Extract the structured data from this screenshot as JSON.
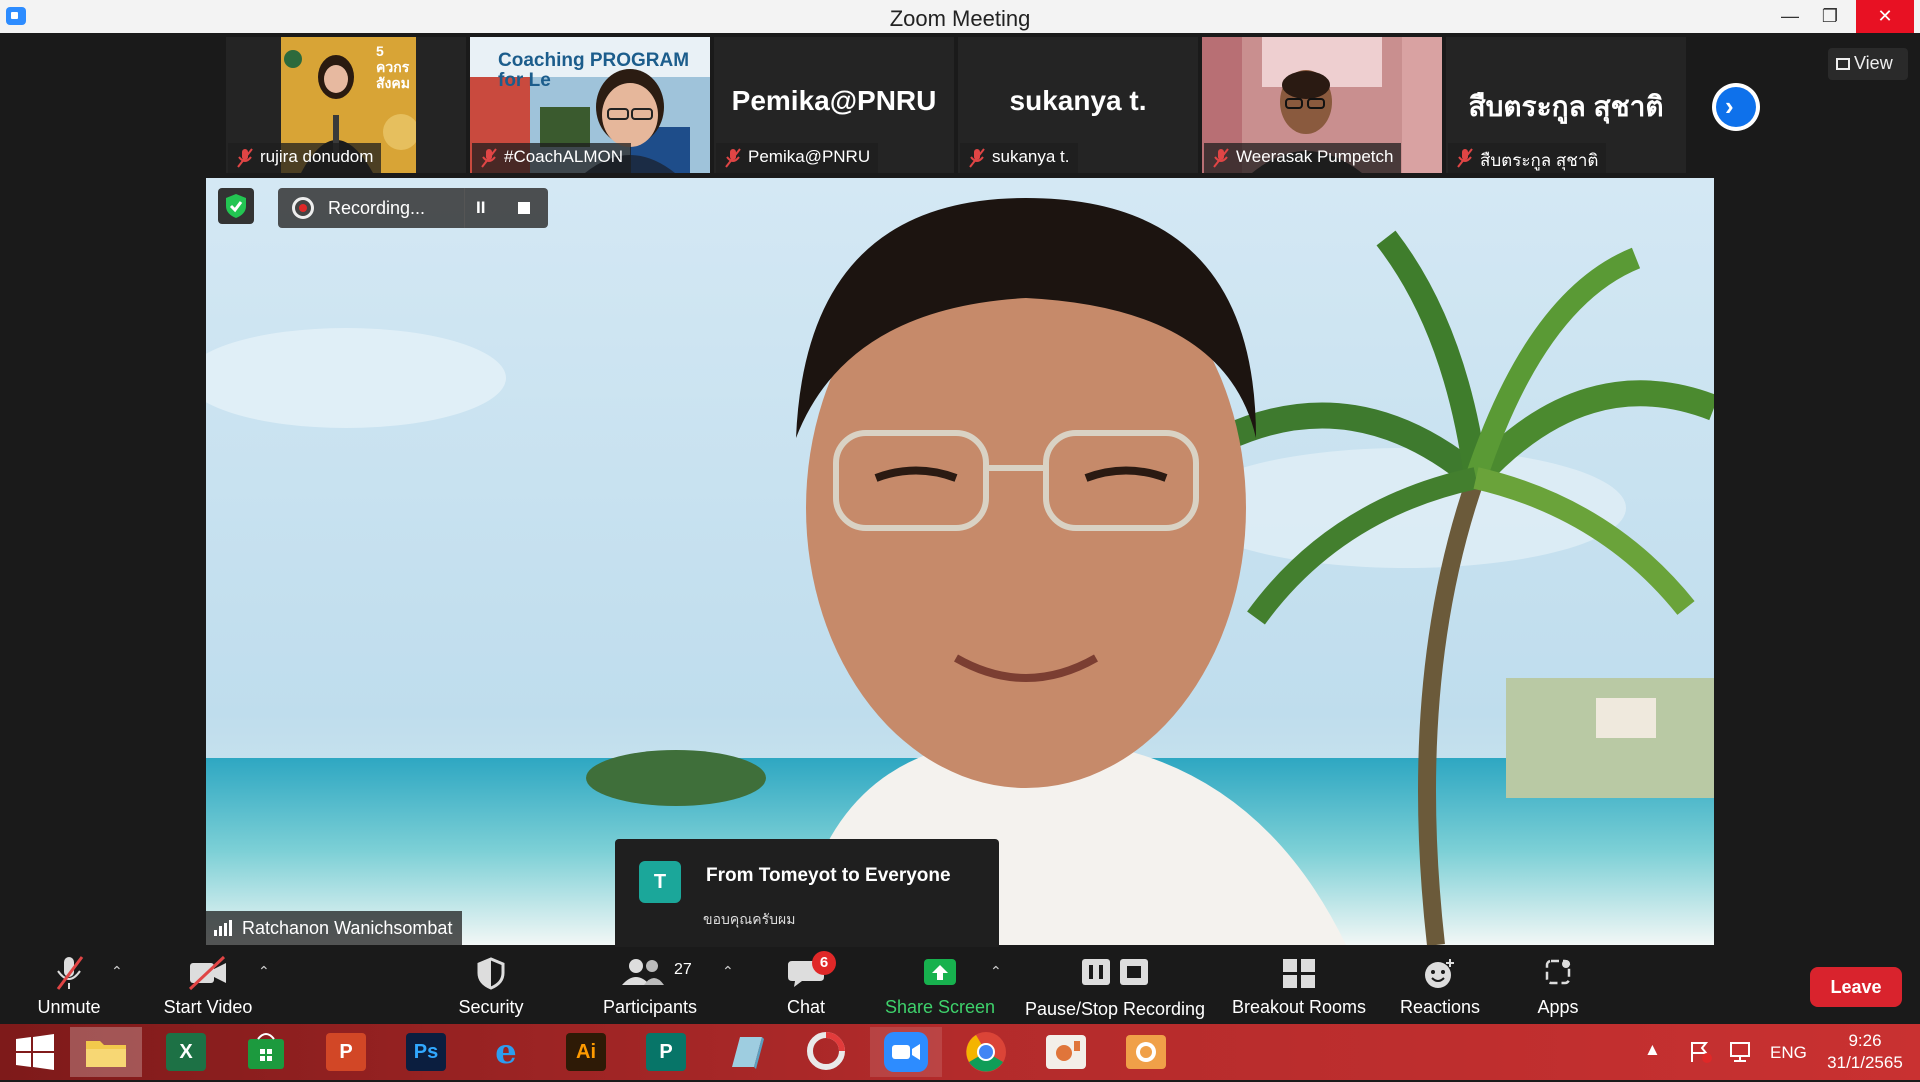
{
  "window": {
    "title": "Zoom Meeting",
    "min": "—",
    "restore": "❐",
    "close": "✕"
  },
  "strip": {
    "participants": [
      {
        "name": "rujira donudom",
        "has_video": true,
        "big_name": ""
      },
      {
        "name": "#CoachALMON",
        "has_video": true,
        "big_name": ""
      },
      {
        "name": "Pemika@PNRU",
        "has_video": false,
        "big_name": "Pemika@PNRU"
      },
      {
        "name": "sukanya t.",
        "has_video": false,
        "big_name": "sukanya t."
      },
      {
        "name": "Weerasak Pumpetch",
        "has_video": true,
        "big_name": ""
      },
      {
        "name": "สืบตระกูล สุชาติ",
        "has_video": false,
        "big_name": "สืบตระกูล สุชาติ"
      }
    ],
    "poster_text": "5 ควกร สังคม",
    "slide_text": "Coaching PROGRAM for Le",
    "next_glyph": "›",
    "view_label": "View"
  },
  "recording": {
    "label": "Recording...",
    "pause": "II"
  },
  "speaker": {
    "name": "Ratchanon Wanichsombat"
  },
  "chat_popup": {
    "avatar_letter": "T",
    "from": "From Tomeyot to Everyone",
    "message": "ขอบคุณครับผม"
  },
  "toolbar": {
    "unmute": "Unmute",
    "start_video": "Start Video",
    "security": "Security",
    "participants": "Participants",
    "participants_count": "27",
    "chat": "Chat",
    "chat_badge": "6",
    "share_screen": "Share Screen",
    "recording": "Pause/Stop Recording",
    "breakout": "Breakout Rooms",
    "reactions": "Reactions",
    "apps": "Apps",
    "leave": "Leave",
    "caret": "⌃"
  },
  "taskbar": {
    "apps": [
      {
        "name": "start",
        "glyph": ""
      },
      {
        "name": "file-explorer",
        "glyph": ""
      },
      {
        "name": "excel",
        "glyph": "X"
      },
      {
        "name": "store",
        "glyph": ""
      },
      {
        "name": "powerpoint",
        "glyph": "P"
      },
      {
        "name": "photoshop",
        "glyph": "Ps"
      },
      {
        "name": "internet-explorer",
        "glyph": "e"
      },
      {
        "name": "illustrator",
        "glyph": "Ai"
      },
      {
        "name": "publisher",
        "glyph": "P"
      },
      {
        "name": "notepad",
        "glyph": ""
      },
      {
        "name": "photoscape",
        "glyph": ""
      },
      {
        "name": "zoom",
        "glyph": ""
      },
      {
        "name": "chrome",
        "glyph": ""
      },
      {
        "name": "app-13",
        "glyph": ""
      },
      {
        "name": "app-14",
        "glyph": ""
      }
    ],
    "lang": "ENG",
    "time": "9:26",
    "date": "31/1/2565"
  },
  "colors": {
    "accent": "#0e71eb",
    "leave": "#d9232d",
    "share": "#17b14e",
    "badge": "#e02828"
  }
}
